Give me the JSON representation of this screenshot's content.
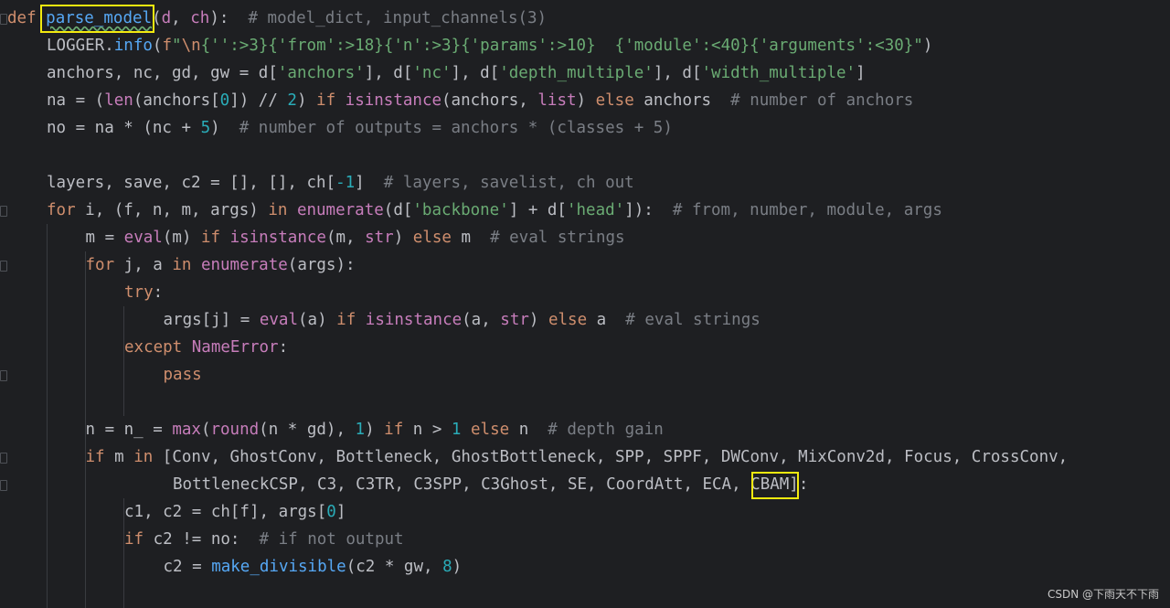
{
  "code_lines": [
    {
      "id": "l1",
      "indent": 0,
      "tokens": [
        [
          "kw",
          "def "
        ],
        [
          "fn",
          "parse_model"
        ],
        [
          "",
          "("
        ],
        [
          "param",
          "d"
        ],
        [
          "",
          ", "
        ],
        [
          "param",
          "ch"
        ],
        [
          "",
          "):  "
        ],
        [
          "cm",
          "# model_dict, input_channels(3)"
        ]
      ]
    },
    {
      "id": "l2",
      "indent": 1,
      "tokens": [
        [
          "",
          "LOGGER."
        ],
        [
          "fn",
          "info"
        ],
        [
          "",
          "("
        ],
        [
          "kw",
          "f"
        ],
        [
          "str",
          "\""
        ],
        [
          "kw",
          "\\n"
        ],
        [
          "str",
          "{'':>3}{'from':>18}{'n':>3}{'params':>10}  {'module':<40}{'arguments':<30}\""
        ],
        [
          "",
          ")"
        ]
      ]
    },
    {
      "id": "l3",
      "indent": 1,
      "tokens": [
        [
          "",
          "anchors, nc, gd, gw = d["
        ],
        [
          "str",
          "'anchors'"
        ],
        [
          "",
          "], d["
        ],
        [
          "str",
          "'nc'"
        ],
        [
          "",
          "], d["
        ],
        [
          "str",
          "'depth_multiple'"
        ],
        [
          "",
          "], d["
        ],
        [
          "str",
          "'width_multiple'"
        ],
        [
          "",
          "]"
        ]
      ]
    },
    {
      "id": "l4",
      "indent": 1,
      "tokens": [
        [
          "",
          "na = ("
        ],
        [
          "bi",
          "len"
        ],
        [
          "",
          "(anchors["
        ],
        [
          "num",
          "0"
        ],
        [
          "",
          "]) // "
        ],
        [
          "num",
          "2"
        ],
        [
          "",
          ") "
        ],
        [
          "kw",
          "if "
        ],
        [
          "bi",
          "isinstance"
        ],
        [
          "",
          "(anchors, "
        ],
        [
          "bi",
          "list"
        ],
        [
          "",
          ") "
        ],
        [
          "kw",
          "else "
        ],
        [
          "",
          "anchors  "
        ],
        [
          "cm",
          "# number of anchors"
        ]
      ]
    },
    {
      "id": "l5",
      "indent": 1,
      "tokens": [
        [
          "",
          "no = na * (nc + "
        ],
        [
          "num",
          "5"
        ],
        [
          "",
          ")  "
        ],
        [
          "cm",
          "# number of outputs = anchors * (classes + 5)"
        ]
      ]
    },
    {
      "id": "l6",
      "indent": 0,
      "tokens": []
    },
    {
      "id": "l7",
      "indent": 1,
      "tokens": [
        [
          "",
          "layers, save, c2 = [], [], ch["
        ],
        [
          "num",
          "-1"
        ],
        [
          "",
          "]  "
        ],
        [
          "cm",
          "# layers, savelist, ch out"
        ]
      ]
    },
    {
      "id": "l8",
      "indent": 1,
      "tokens": [
        [
          "kw",
          "for "
        ],
        [
          "",
          "i, (f, n, m, args) "
        ],
        [
          "kw",
          "in "
        ],
        [
          "bi",
          "enumerate"
        ],
        [
          "",
          "(d["
        ],
        [
          "str",
          "'backbone'"
        ],
        [
          "",
          "] + d["
        ],
        [
          "str",
          "'head'"
        ],
        [
          "",
          "]):  "
        ],
        [
          "cm",
          "# from, number, module, args"
        ]
      ]
    },
    {
      "id": "l9",
      "indent": 2,
      "tokens": [
        [
          "",
          "m = "
        ],
        [
          "bi",
          "eval"
        ],
        [
          "",
          "(m) "
        ],
        [
          "kw",
          "if "
        ],
        [
          "bi",
          "isinstance"
        ],
        [
          "",
          "(m, "
        ],
        [
          "bi",
          "str"
        ],
        [
          "",
          ") "
        ],
        [
          "kw",
          "else "
        ],
        [
          "",
          "m  "
        ],
        [
          "cm",
          "# eval strings"
        ]
      ]
    },
    {
      "id": "l10",
      "indent": 2,
      "tokens": [
        [
          "kw",
          "for "
        ],
        [
          "",
          "j, a "
        ],
        [
          "kw",
          "in "
        ],
        [
          "bi",
          "enumerate"
        ],
        [
          "",
          "(args):"
        ]
      ]
    },
    {
      "id": "l11",
      "indent": 3,
      "tokens": [
        [
          "kw",
          "try"
        ],
        [
          "",
          ":"
        ]
      ]
    },
    {
      "id": "l12",
      "indent": 4,
      "tokens": [
        [
          "",
          "args[j] = "
        ],
        [
          "bi",
          "eval"
        ],
        [
          "",
          "(a) "
        ],
        [
          "kw",
          "if "
        ],
        [
          "bi",
          "isinstance"
        ],
        [
          "",
          "(a, "
        ],
        [
          "bi",
          "str"
        ],
        [
          "",
          ") "
        ],
        [
          "kw",
          "else "
        ],
        [
          "",
          "a  "
        ],
        [
          "cm",
          "# eval strings"
        ]
      ]
    },
    {
      "id": "l13",
      "indent": 3,
      "tokens": [
        [
          "kw",
          "except "
        ],
        [
          "bi",
          "NameError"
        ],
        [
          "",
          ":"
        ]
      ]
    },
    {
      "id": "l14",
      "indent": 4,
      "tokens": [
        [
          "kw",
          "pass"
        ]
      ]
    },
    {
      "id": "l15",
      "indent": 0,
      "tokens": []
    },
    {
      "id": "l16",
      "indent": 2,
      "tokens": [
        [
          "",
          "n = n_ = "
        ],
        [
          "bi",
          "max"
        ],
        [
          "",
          "("
        ],
        [
          "bi",
          "round"
        ],
        [
          "",
          "(n * gd), "
        ],
        [
          "num",
          "1"
        ],
        [
          "",
          ") "
        ],
        [
          "kw",
          "if "
        ],
        [
          "",
          "n > "
        ],
        [
          "num",
          "1 "
        ],
        [
          "kw",
          "else "
        ],
        [
          "",
          "n  "
        ],
        [
          "cm",
          "# depth gain"
        ]
      ]
    },
    {
      "id": "l17",
      "indent": 2,
      "tokens": [
        [
          "kw",
          "if "
        ],
        [
          "",
          "m "
        ],
        [
          "kw",
          "in "
        ],
        [
          "",
          "[Conv, GhostConv, Bottleneck, GhostBottleneck, SPP, SPPF, DWConv, MixConv2d, Focus, CrossConv,"
        ]
      ]
    },
    {
      "id": "l18",
      "indent": 4,
      "tokens": [
        [
          "",
          "BottleneckCSP, C3, C3TR, C3SPP, C3Ghost, SE, CoordAtt, ECA, CBAM]:"
        ]
      ]
    },
    {
      "id": "l19",
      "indent": 3,
      "tokens": [
        [
          "",
          "c1, c2 = ch[f], args["
        ],
        [
          "num",
          "0"
        ],
        [
          "",
          "]"
        ]
      ]
    },
    {
      "id": "l20",
      "indent": 3,
      "tokens": [
        [
          "kw",
          "if "
        ],
        [
          "",
          "c2 != no:  "
        ],
        [
          "cm",
          "# if not output"
        ]
      ]
    },
    {
      "id": "l21",
      "indent": 4,
      "tokens": [
        [
          "",
          "c2 = "
        ],
        [
          "fn",
          "make_divisible"
        ],
        [
          "",
          "(c2 * gw, "
        ],
        [
          "num",
          "8"
        ],
        [
          "",
          ")"
        ]
      ]
    },
    {
      "id": "l22",
      "indent": 0,
      "tokens": []
    }
  ],
  "watermark": "CSDN @下雨天不下雨",
  "colors": {
    "background": "#1e1f22",
    "keyword": "#cf8e6d",
    "function": "#56a8f5",
    "builtin": "#c77dbb",
    "string": "#6aab73",
    "number": "#2aacb8",
    "comment": "#7a7e85",
    "highlight_box": "#f2e90f"
  }
}
